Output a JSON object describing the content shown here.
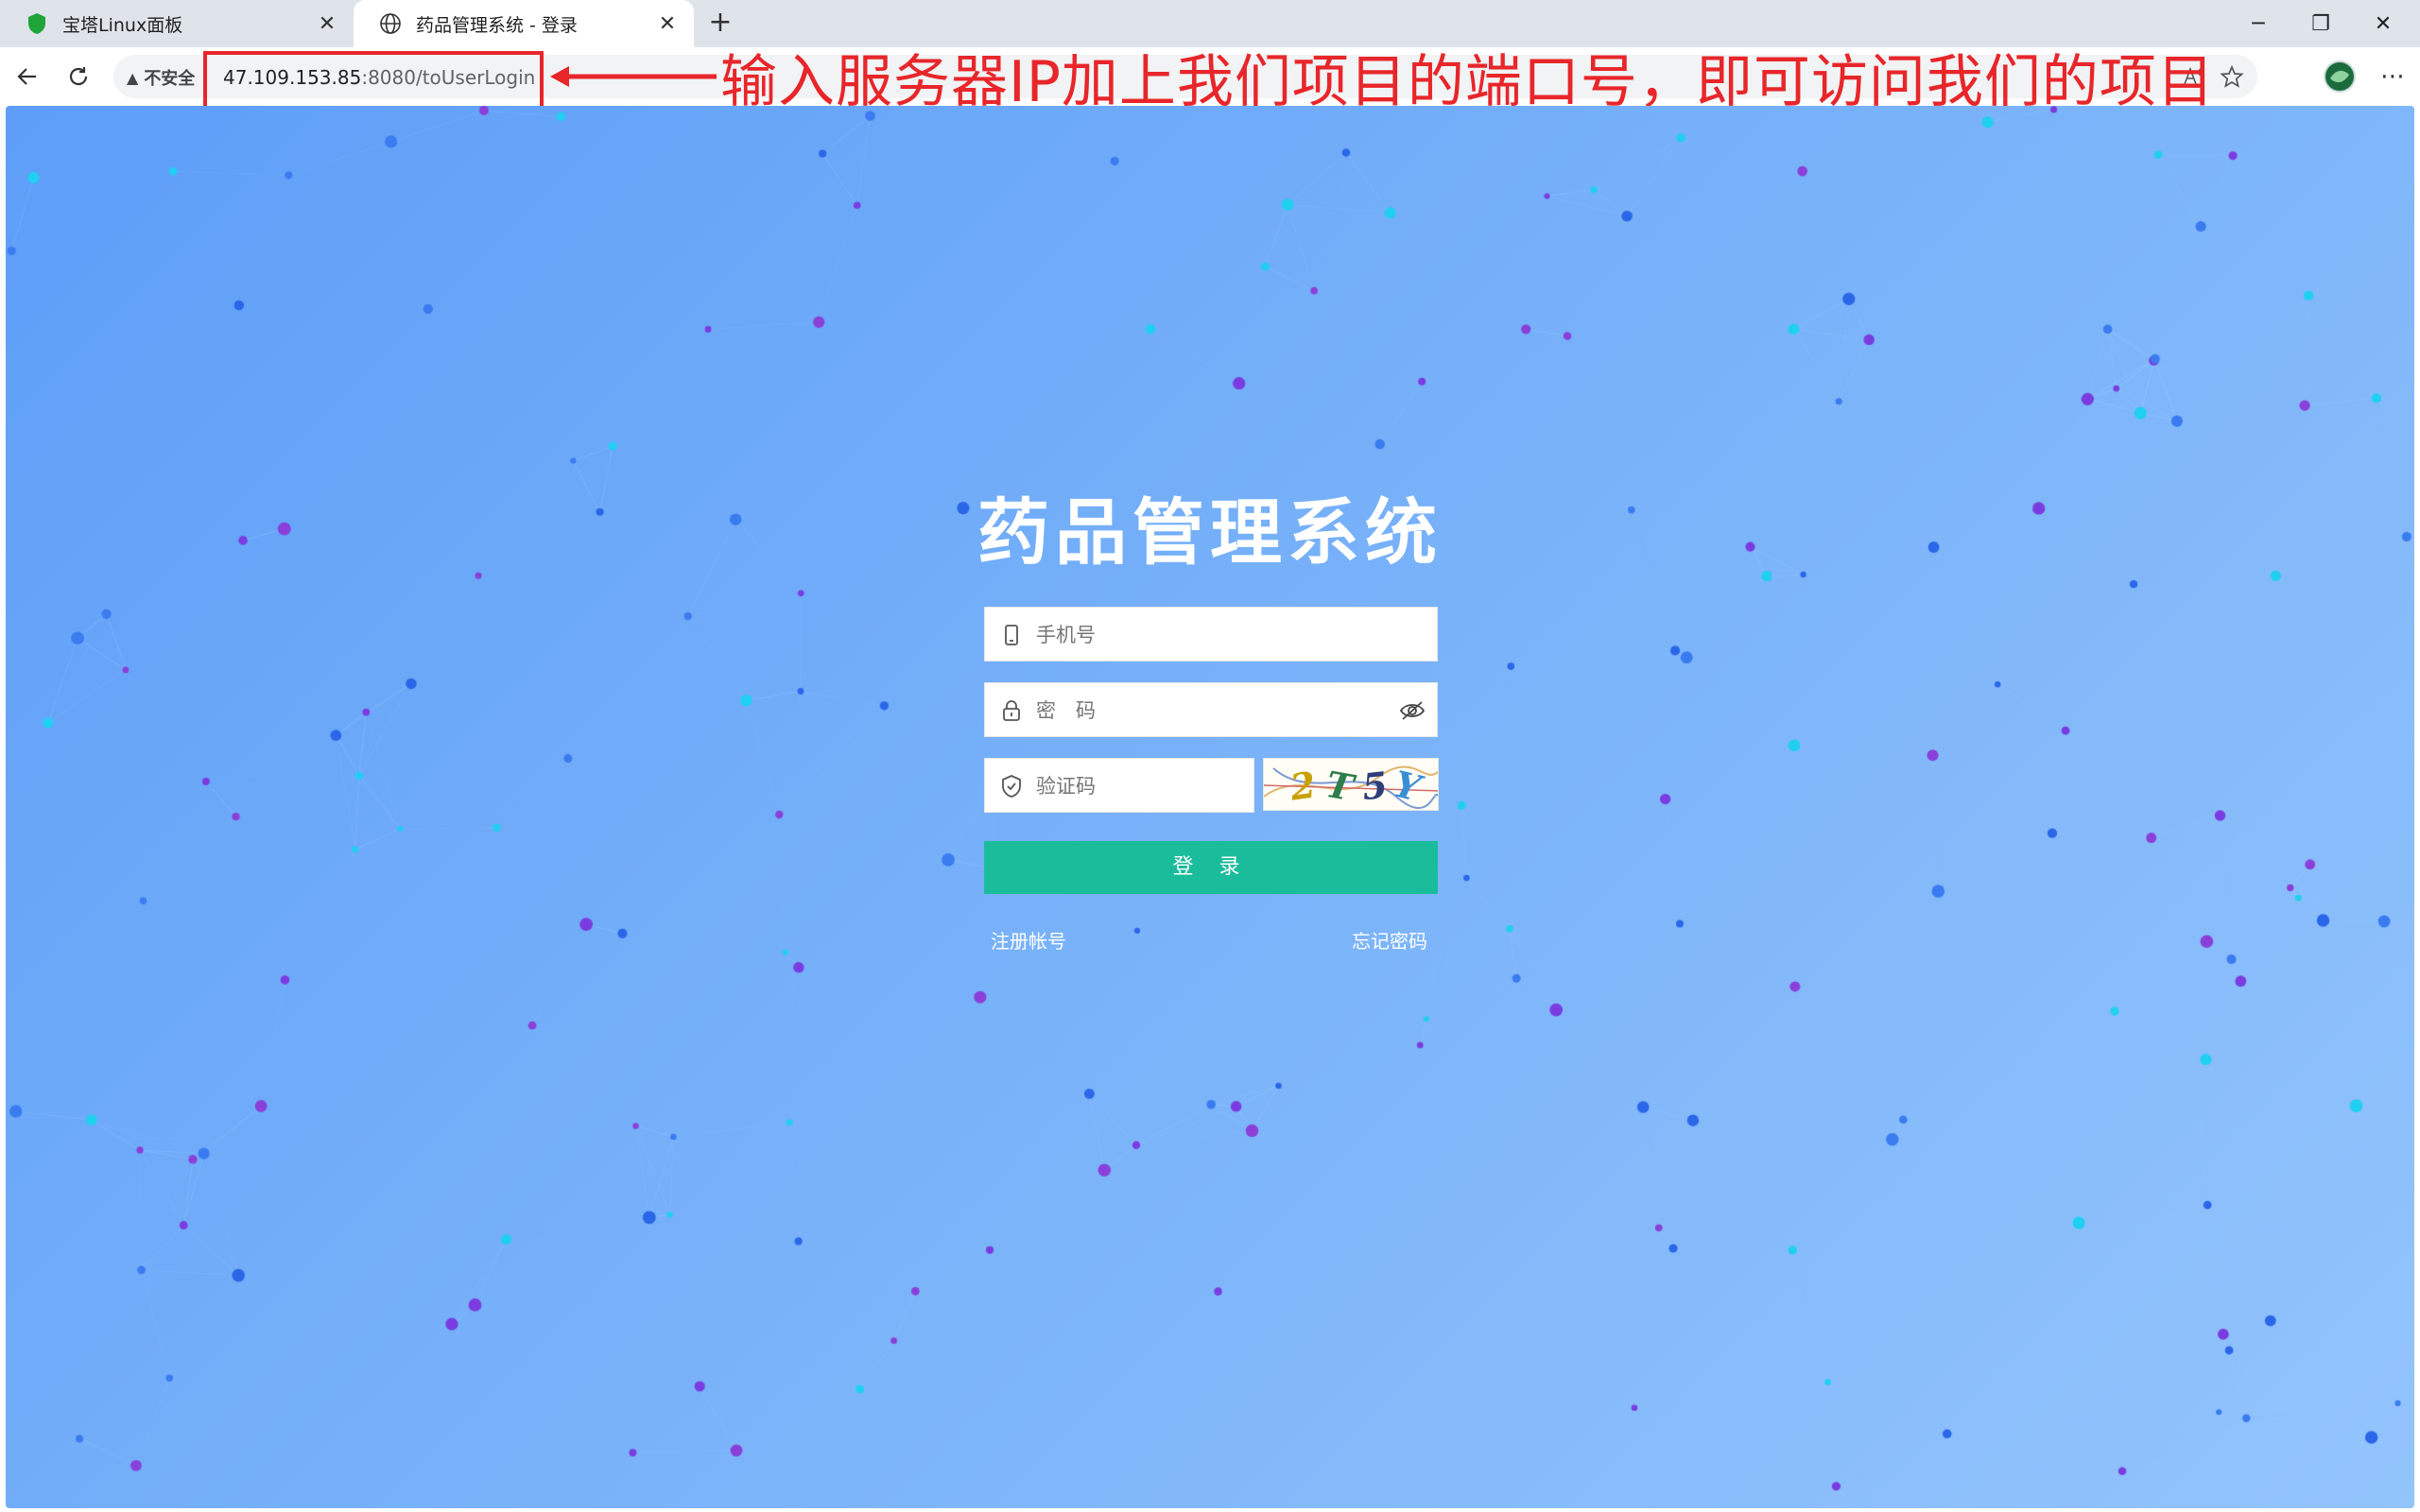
{
  "browser": {
    "tabs": [
      {
        "title": "宝塔Linux面板",
        "active": false,
        "icon": "shield-icon"
      },
      {
        "title": "药品管理系统 - 登录",
        "active": true,
        "icon": "globe-icon"
      }
    ],
    "security_label": "不安全",
    "url_host": "47.109.153.85",
    "url_rest": ":8080/toUserLogin"
  },
  "annotation": {
    "text": "输入服务器IP加上我们项目的端口号，即可访问我们的项目",
    "color": "#e8262a"
  },
  "login": {
    "title": "药品管理系统",
    "phone_placeholder": "手机号",
    "password_placeholder": "密　码",
    "captcha_placeholder": "验证码",
    "captcha_chars": [
      "2",
      "T",
      "5",
      "Y"
    ],
    "login_label": "登 录",
    "register_label": "注册帐号",
    "forgot_label": "忘记密码",
    "accent": "#1bbc9b"
  }
}
